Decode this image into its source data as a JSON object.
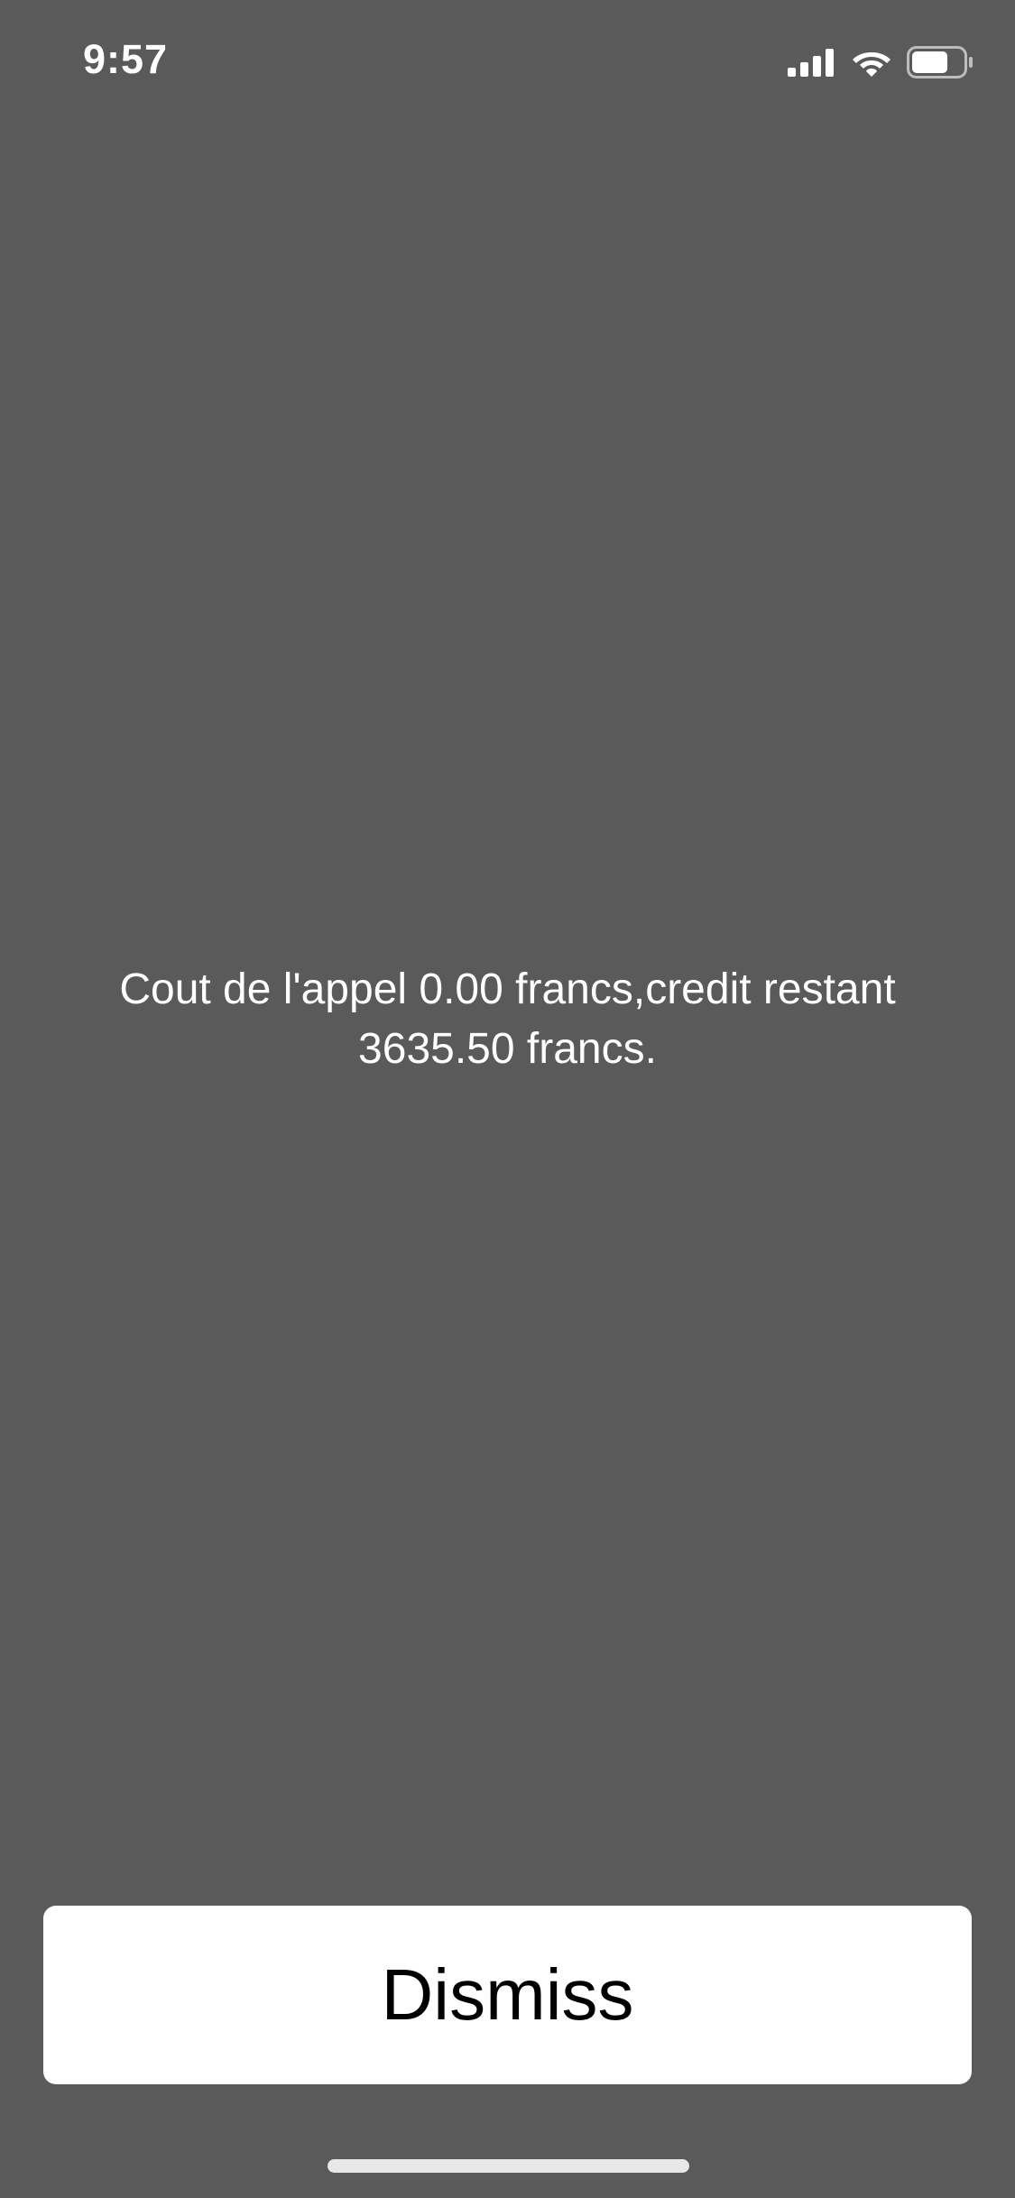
{
  "status_bar": {
    "time": "9:57",
    "icons": [
      "cellular-signal-icon",
      "wifi-icon",
      "battery-icon"
    ],
    "battery_level": 0.7
  },
  "dialog": {
    "message": "Cout de l'appel 0.00 francs,credit restant 3635.50 francs.",
    "dismiss_label": "Dismiss"
  },
  "colors": {
    "background": "#5a5a5a",
    "button_background": "#ffffff",
    "button_text": "#000000",
    "message_text": "#ffffff"
  }
}
